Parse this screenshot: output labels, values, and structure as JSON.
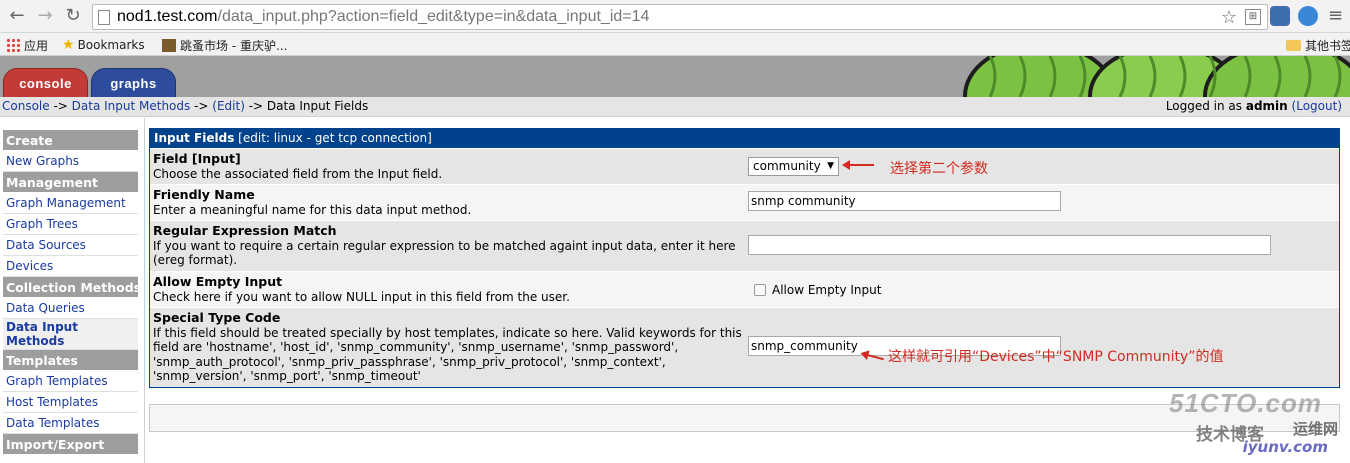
{
  "browser": {
    "url_host": "nod1.test.com",
    "url_path": "/data_input.php?action=field_edit&type=in&data_input_id=14",
    "bookmarks": [
      {
        "label": "应用",
        "icon": "apps-grid-icon"
      },
      {
        "label": "Bookmarks",
        "icon": "star-icon"
      },
      {
        "label": "跳蚤市场 - 重庆驴...",
        "icon": "site-favicon"
      }
    ],
    "other_bookmarks": "其他书签"
  },
  "cacti": {
    "tabs": [
      {
        "label": "console",
        "color": "#c43a36"
      },
      {
        "label": "graphs",
        "color": "#2d4d9c"
      }
    ],
    "breadcrumb": {
      "console": "Console",
      "arrow1": " -> ",
      "methods": "Data Input Methods",
      "arrow2": " -> ",
      "edit": "(Edit)",
      "arrow3": " -> ",
      "current": "Data Input Fields"
    },
    "login": {
      "prefix": "Logged in as ",
      "user": "admin",
      "logout": "(Logout)"
    }
  },
  "sidebar": {
    "sections": [
      {
        "header": "Create",
        "items": [
          "New Graphs"
        ]
      },
      {
        "header": "Management",
        "items": [
          "Graph Management",
          "Graph Trees",
          "Data Sources",
          "Devices"
        ]
      },
      {
        "header": "Collection Methods",
        "items": [
          "Data Queries",
          "Data Input Methods"
        ]
      },
      {
        "header": "Templates",
        "items": [
          "Graph Templates",
          "Host Templates",
          "Data Templates"
        ]
      },
      {
        "header": "Import/Export",
        "items": []
      }
    ]
  },
  "panel": {
    "title_bold": "Input Fields",
    "title_rest": " [edit: linux - get tcp connection]",
    "fields": [
      {
        "title": "Field [Input]",
        "desc": "Choose the associated field from the Input field.",
        "value": "community"
      },
      {
        "title": "Friendly Name",
        "desc": "Enter a meaningful name for this data input method.",
        "value": "snmp community"
      },
      {
        "title": "Regular Expression Match",
        "desc": "If you want to require a certain regular expression to be matched againt input data, enter it here (ereg format).",
        "value": ""
      },
      {
        "title": "Allow Empty Input",
        "desc": "Check here if you want to allow NULL input in this field from the user.",
        "checkbox_label": "Allow Empty Input"
      },
      {
        "title": "Special Type Code",
        "desc": "If this field should be treated specially by host templates, indicate so here. Valid keywords for this field are 'hostname', 'host_id', 'snmp_community', 'snmp_username', 'snmp_password', 'snmp_auth_protocol', 'snmp_priv_passphrase', 'snmp_priv_protocol', 'snmp_context', 'snmp_version', 'snmp_port', 'snmp_timeout'",
        "value": "snmp_community"
      }
    ]
  },
  "annotations": {
    "first": "选择第二个参数",
    "second": "这样就可引用“Devices”中“SNMP Community”的值"
  },
  "watermark": {
    "line1": "51CTO.com",
    "line2": "技术博客",
    "line3": "运维网",
    "line4": "iyunv.com"
  }
}
